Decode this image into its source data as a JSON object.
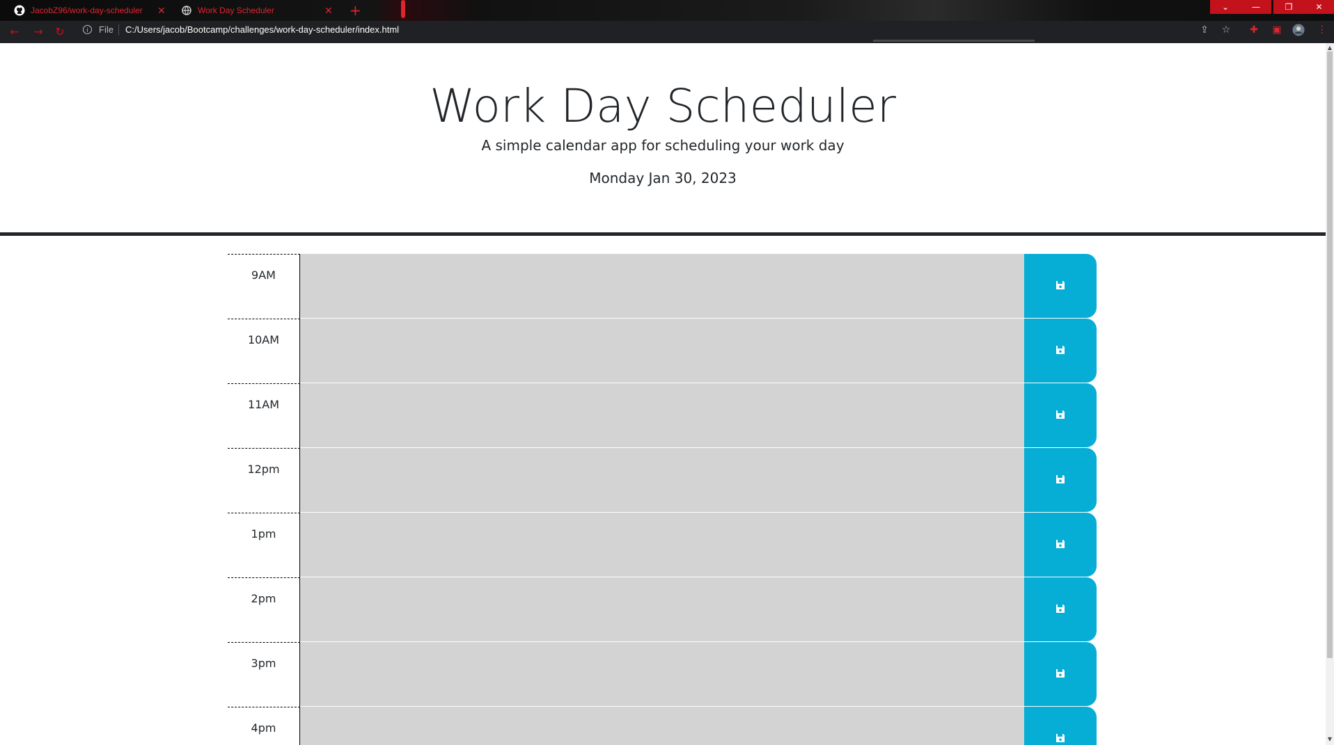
{
  "browser": {
    "tabs": [
      {
        "title": "JacobZ96/work-day-scheduler",
        "icon": "github-icon"
      },
      {
        "title": "Work Day Scheduler",
        "icon": "globe-icon"
      }
    ],
    "new_tab": "+",
    "file_label": "File",
    "url": "C:/Users/jacob/Bootcamp/challenges/work-day-scheduler/index.html",
    "accent_color": "#e0252f"
  },
  "header": {
    "title": "Work Day Scheduler",
    "subtitle": "A simple calendar app for scheduling your work day",
    "current_day": "Monday Jan 30, 2023"
  },
  "schedule": {
    "block_color": "#d3d3d3",
    "button_color": "#06aed5",
    "save_icon": "floppy-disk-icon",
    "hours": [
      {
        "label": "9AM",
        "text": ""
      },
      {
        "label": "10AM",
        "text": ""
      },
      {
        "label": "11AM",
        "text": ""
      },
      {
        "label": "12pm",
        "text": ""
      },
      {
        "label": "1pm",
        "text": ""
      },
      {
        "label": "2pm",
        "text": ""
      },
      {
        "label": "3pm",
        "text": ""
      },
      {
        "label": "4pm",
        "text": ""
      }
    ]
  }
}
